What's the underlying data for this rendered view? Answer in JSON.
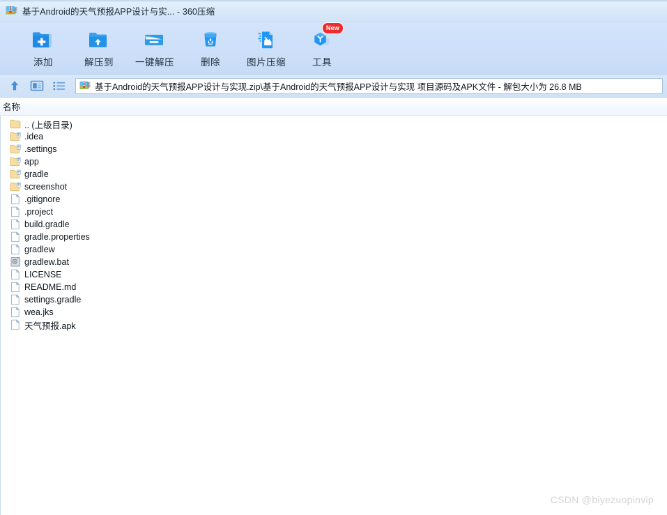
{
  "window": {
    "title": "基于Android的天气预报APP设计与实... - 360压缩",
    "app_icon": "zip-archive-icon"
  },
  "toolbar": {
    "buttons": [
      {
        "label": "添加",
        "icon": "folder-add-icon",
        "badge": ""
      },
      {
        "label": "解压到",
        "icon": "folder-extract-icon",
        "badge": ""
      },
      {
        "label": "一键解压",
        "icon": "folder-oneclick-icon",
        "badge": ""
      },
      {
        "label": "删除",
        "icon": "recycle-bin-icon",
        "badge": ""
      },
      {
        "label": "图片压缩",
        "icon": "image-compress-icon",
        "badge": ""
      },
      {
        "label": "工具",
        "icon": "tools-cube-icon",
        "badge": "New"
      }
    ]
  },
  "path_bar": {
    "nav_icons": [
      "up-arrow-icon",
      "preview-pane-icon",
      "list-view-icon"
    ],
    "zip_icon": "zip-archive-icon",
    "path": "基于Android的天气预报APP设计与实现.zip\\基于Android的天气预报APP设计与实现 项目源码及APK文件 - 解包大小为 26.8 MB"
  },
  "list": {
    "columns": [
      "名称"
    ],
    "rows": [
      {
        "name": ".. (上级目录)",
        "icon": "folder-plain-icon"
      },
      {
        "name": ".idea",
        "icon": "folder-icon"
      },
      {
        "name": ".settings",
        "icon": "folder-icon"
      },
      {
        "name": "app",
        "icon": "folder-icon"
      },
      {
        "name": "gradle",
        "icon": "folder-icon"
      },
      {
        "name": "screenshot",
        "icon": "folder-icon"
      },
      {
        "name": ".gitignore",
        "icon": "file-icon"
      },
      {
        "name": ".project",
        "icon": "file-icon"
      },
      {
        "name": "build.gradle",
        "icon": "file-icon"
      },
      {
        "name": "gradle.properties",
        "icon": "file-icon"
      },
      {
        "name": "gradlew",
        "icon": "file-icon"
      },
      {
        "name": "gradlew.bat",
        "icon": "batch-file-icon"
      },
      {
        "name": "LICENSE",
        "icon": "file-icon"
      },
      {
        "name": "README.md",
        "icon": "file-icon"
      },
      {
        "name": "settings.gradle",
        "icon": "file-icon"
      },
      {
        "name": "wea.jks",
        "icon": "file-icon"
      },
      {
        "name": "天气预报.apk",
        "icon": "file-icon"
      }
    ]
  },
  "watermark": {
    "text": "CSDN @biyezuopinvip"
  },
  "colors": {
    "title_bar": "#d5e6f8",
    "toolbar": "#cfe1fa",
    "accent_blue": "#2196f3",
    "folder_yellow": "#f5d07a",
    "badge_red": "#ef2b2b",
    "list_bg": "#ffffff"
  }
}
